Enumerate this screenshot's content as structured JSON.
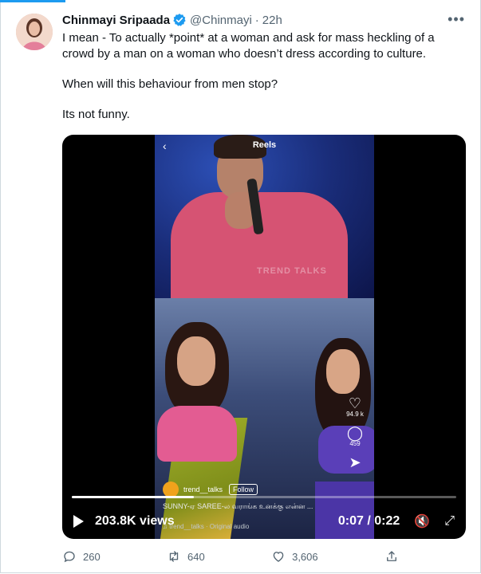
{
  "tweet": {
    "author_name": "Chinmayi Sripaada",
    "handle": "@Chinmayi",
    "separator": "·",
    "time": "22h",
    "more_icon": "ellipsis-icon",
    "paragraphs": [
      "I mean - To actually *point* at a woman and ask for mass heckling of a crowd by a man on a woman who doesn’t dress according to culture.",
      "When will this behaviour from men stop?",
      "Its not funny."
    ]
  },
  "video": {
    "overlay_title": "Reels",
    "watermark": "TREND TALKS",
    "creator": "trend__talks",
    "follow_label": "Follow",
    "caption": "SUNNY-ஏ SAREE-ல வராங்க உனக்கு என்ன ...",
    "audio_label": "♫ trend__talks · Original audio",
    "like_count": "94.9 k",
    "comment_count": "459",
    "views_label": "203.8K views",
    "time_readout": "0:07 / 0:22",
    "progress_fraction": 0.318
  },
  "actions": {
    "reply_count": "260",
    "retweet_count": "640",
    "like_count": "3,606"
  },
  "colors": {
    "accent": "#1d9bf0",
    "muted_text": "#536471",
    "text": "#0f1419"
  }
}
